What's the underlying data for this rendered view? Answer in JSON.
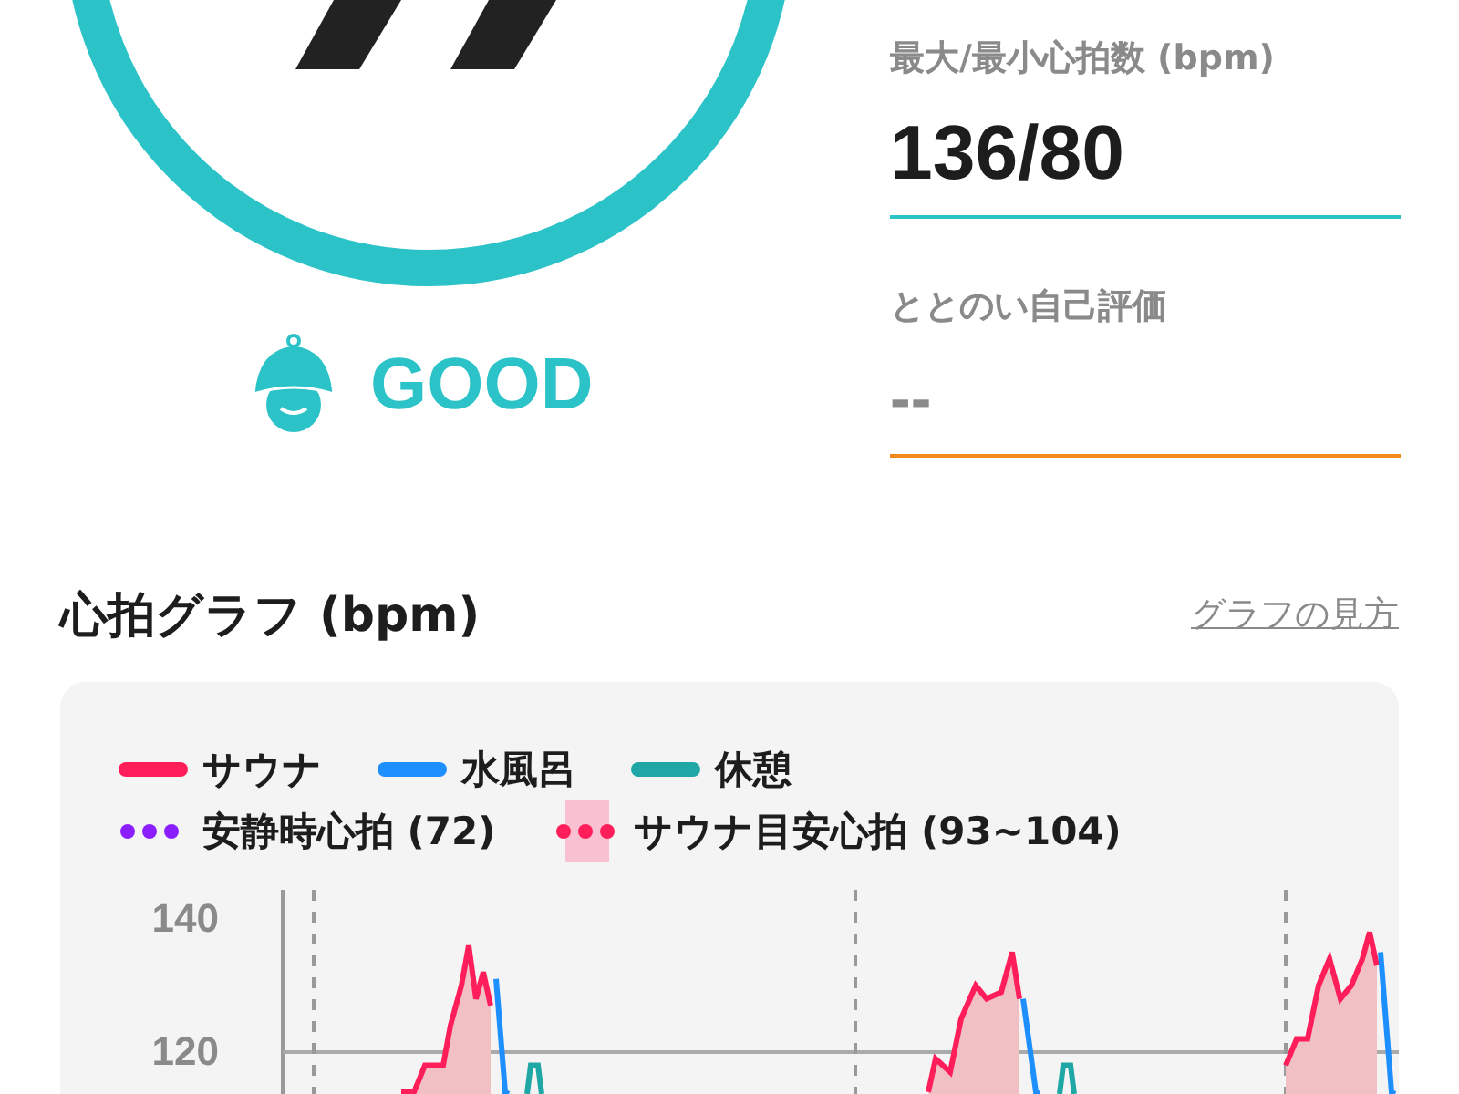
{
  "rating": {
    "label": "GOOD"
  },
  "stats": [
    {
      "kind": "value",
      "label": "最大/最小心拍数 (bpm)",
      "value": "136/80",
      "color": "#2bc3c8"
    },
    {
      "kind": "empty",
      "label": "ととのい自己評価",
      "value": "--",
      "color": "#f08a1c"
    }
  ],
  "graph": {
    "title": "心拍グラフ (bpm)",
    "help_link": "グラフの見方",
    "legend_rows": [
      {
        "items": [
          {
            "kind": "line",
            "label": "サウナ",
            "color": "#ff1e5a"
          },
          {
            "kind": "line",
            "label": "水風呂",
            "color": "#1e8fff"
          },
          {
            "kind": "line",
            "label": "休憩",
            "color": "#1fa7a5"
          }
        ]
      },
      {
        "items": [
          {
            "kind": "dots",
            "label": "安静時心拍 (72)",
            "color": "#8a1eff"
          },
          {
            "kind": "band",
            "label": "サウナ目安心拍 (93~104)",
            "color": "#ff1e5a"
          }
        ]
      }
    ],
    "y_ticks": [
      "140",
      "120"
    ]
  }
}
